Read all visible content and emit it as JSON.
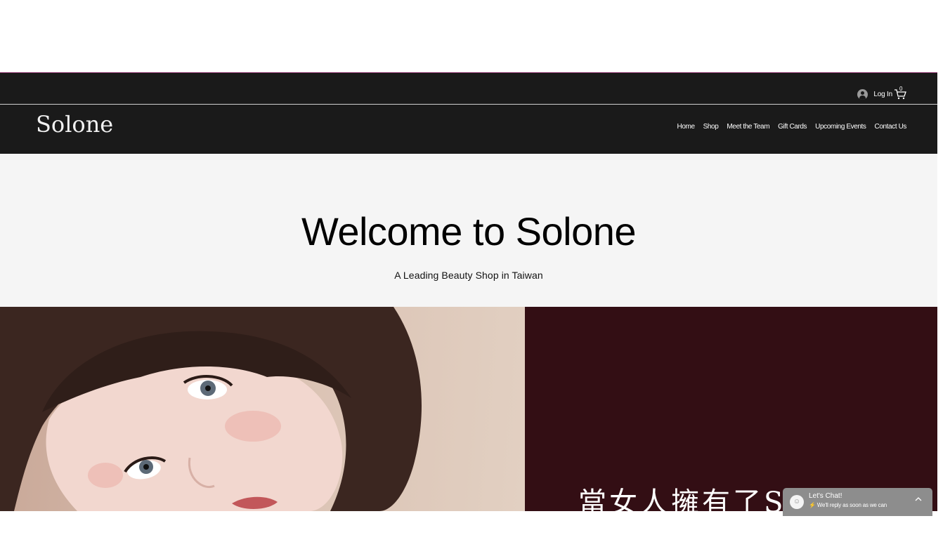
{
  "header": {
    "login_label": "Log In",
    "cart_count": "0",
    "logo": "Solone",
    "nav": [
      {
        "label": "Home"
      },
      {
        "label": "Shop"
      },
      {
        "label": "Meet the Team"
      },
      {
        "label": "Gift Cards"
      },
      {
        "label": "Upcoming Events"
      },
      {
        "label": "Contact Us"
      }
    ]
  },
  "hero": {
    "title": "Welcome to Solone",
    "subtitle": "A Leading Beauty Shop in Taiwan"
  },
  "promo": {
    "text": "當女人擁有了Solone"
  },
  "chat": {
    "title": "Let's Chat!",
    "subtitle": "⚡ We'll reply as soon as we can"
  },
  "colors": {
    "header_bg": "#1a1a1a",
    "hero_bg": "#f5f5f5",
    "promo_bg": "#330e14",
    "chat_bg": "#8d8d8d"
  },
  "icons": [
    "avatar-icon",
    "cart-icon",
    "chat-icon",
    "chevron-up-icon"
  ]
}
